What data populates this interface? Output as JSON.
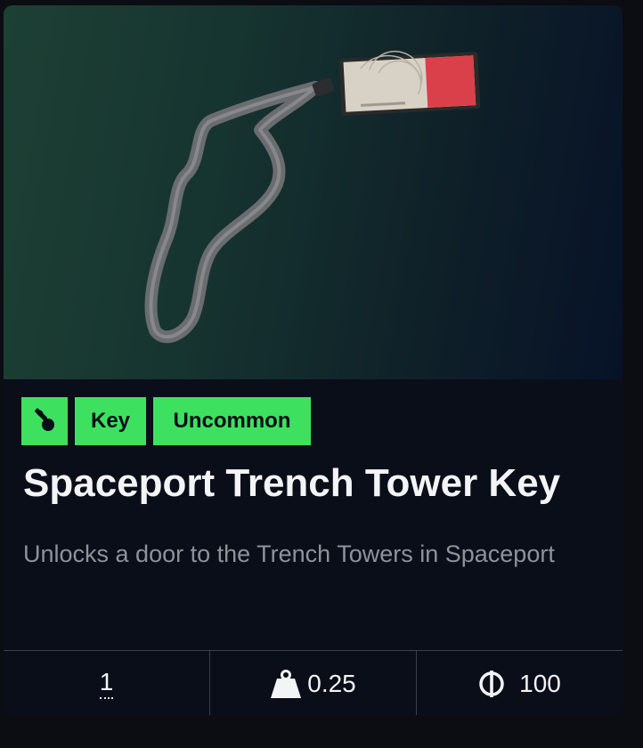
{
  "item": {
    "image_alt": "lanyard keycard",
    "tags": {
      "category_icon": "key-icon",
      "type": "Key",
      "rarity": "Uncommon"
    },
    "name": "Spaceport Trench Tower Key",
    "description": "Unlocks a door to the Trench Towers in Spaceport",
    "stats": {
      "quantity": "1",
      "weight_icon": "weight-icon",
      "weight": "0.25",
      "currency_icon": "coin-icon",
      "price": "100"
    }
  },
  "colors": {
    "tag_background": "#3ee05f",
    "card_background": "#0a0e19",
    "title_text": "#f3f4f6",
    "description_text": "#8e9299"
  }
}
